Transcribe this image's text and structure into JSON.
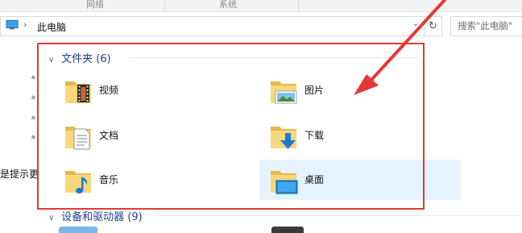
{
  "ribbon": {
    "groups": [
      "网络",
      "系统"
    ]
  },
  "address_bar": {
    "path": "此电脑"
  },
  "search": {
    "placeholder": "搜索\"此电脑\""
  },
  "nav": {
    "clipped_text": "是提示更"
  },
  "groups": [
    {
      "title": "文件夹 (6)"
    },
    {
      "title": "设备和驱动器 (9)"
    }
  ],
  "folders": [
    {
      "name": "视频",
      "icon": "video-folder-icon",
      "selected": false
    },
    {
      "name": "图片",
      "icon": "pictures-folder-icon",
      "selected": false
    },
    {
      "name": "文档",
      "icon": "documents-folder-icon",
      "selected": false
    },
    {
      "name": "下载",
      "icon": "downloads-folder-icon",
      "selected": false
    },
    {
      "name": "音乐",
      "icon": "music-folder-icon",
      "selected": false
    },
    {
      "name": "桌面",
      "icon": "desktop-folder-icon",
      "selected": true
    }
  ],
  "colors": {
    "annotation_red": "#e53935",
    "selection_bg": "#e5f3ff",
    "header_text": "#1f3f8f"
  }
}
